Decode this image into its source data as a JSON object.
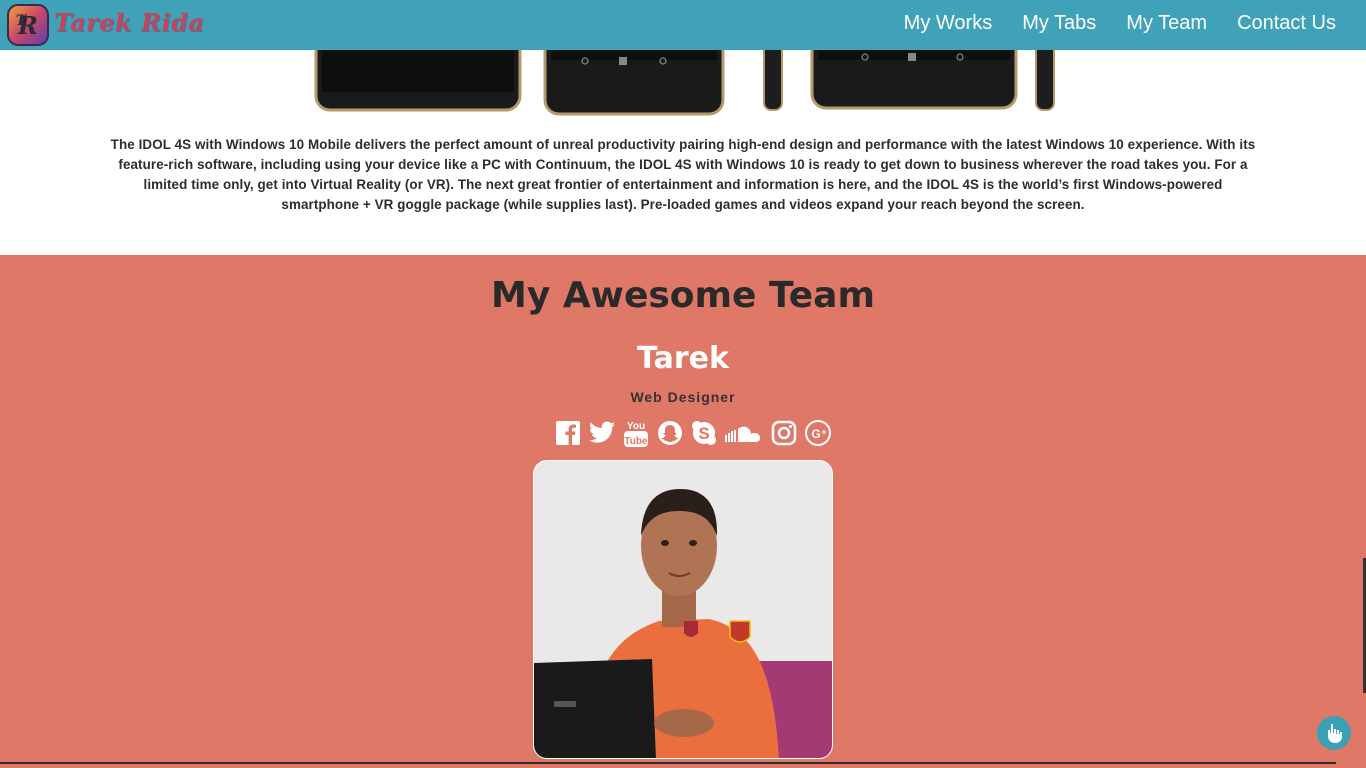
{
  "nav": {
    "brand": "Tarek Rida",
    "links": [
      "My Works",
      "My Tabs",
      "My Team",
      "Contact Us"
    ]
  },
  "product": {
    "description": "The IDOL 4S with Windows 10 Mobile delivers the perfect amount of unreal productivity pairing high-end design and performance with the latest Windows 10 experience. With its feature-rich software, including using your device like a PC with Continuum, the IDOL 4S with Windows 10 is ready to get down to business wherever the road takes you. For a limited time only, get into Virtual Reality (or VR). The next great frontier of entertainment and information is here, and the IDOL 4S is the world’s first Windows-powered smartphone + VR goggle package (while supplies last). Pre-loaded games and videos expand your reach beyond the screen."
  },
  "team": {
    "title": "My Awesome Team",
    "member": {
      "name": "Tarek",
      "role": "Web Designer",
      "socials": [
        "facebook-icon",
        "twitter-icon",
        "youtube-icon",
        "snapchat-icon",
        "skype-icon",
        "soundcloud-icon",
        "instagram-icon",
        "google-plus-icon"
      ]
    }
  },
  "colors": {
    "navbar": "#3fa2b8",
    "team_bg": "#df7867",
    "brand_text": "#c2455c"
  }
}
